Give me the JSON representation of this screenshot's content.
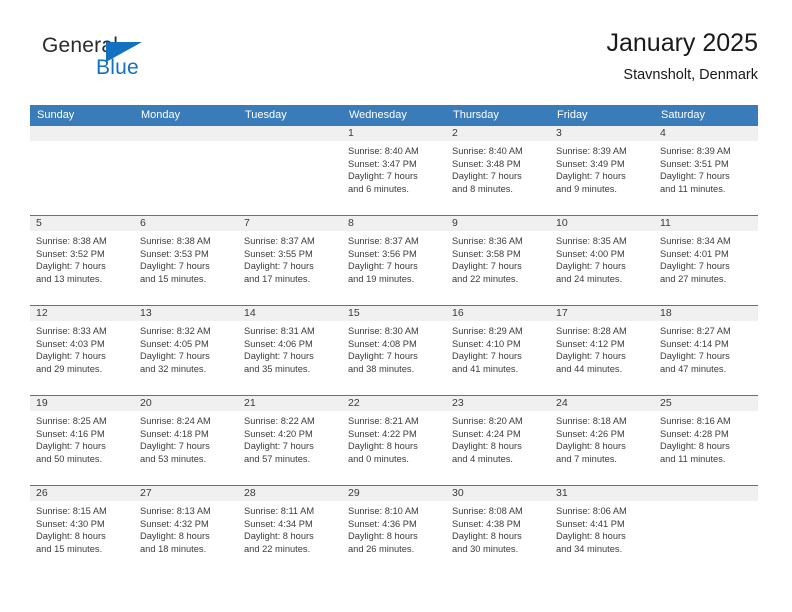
{
  "brand": {
    "name_top": "General",
    "name_bottom": "Blue",
    "accent_color": "#1271c0"
  },
  "header": {
    "title": "January 2025",
    "subtitle": "Stavnsholt, Denmark",
    "header_bg_color": "#3a7cb9",
    "daynum_bg_color": "#f0f0f0"
  },
  "weekdays": [
    "Sunday",
    "Monday",
    "Tuesday",
    "Wednesday",
    "Thursday",
    "Friday",
    "Saturday"
  ],
  "labels": {
    "sunrise": "Sunrise:",
    "sunset": "Sunset:",
    "daylight": "Daylight:"
  },
  "weeks": [
    [
      {
        "day": "",
        "empty": true
      },
      {
        "day": "",
        "empty": true
      },
      {
        "day": "",
        "empty": true
      },
      {
        "day": "1",
        "sunrise": "Sunrise: 8:40 AM",
        "sunset": "Sunset: 3:47 PM",
        "daylight1": "Daylight: 7 hours",
        "daylight2": "and 6 minutes."
      },
      {
        "day": "2",
        "sunrise": "Sunrise: 8:40 AM",
        "sunset": "Sunset: 3:48 PM",
        "daylight1": "Daylight: 7 hours",
        "daylight2": "and 8 minutes."
      },
      {
        "day": "3",
        "sunrise": "Sunrise: 8:39 AM",
        "sunset": "Sunset: 3:49 PM",
        "daylight1": "Daylight: 7 hours",
        "daylight2": "and 9 minutes."
      },
      {
        "day": "4",
        "sunrise": "Sunrise: 8:39 AM",
        "sunset": "Sunset: 3:51 PM",
        "daylight1": "Daylight: 7 hours",
        "daylight2": "and 11 minutes."
      }
    ],
    [
      {
        "day": "5",
        "sunrise": "Sunrise: 8:38 AM",
        "sunset": "Sunset: 3:52 PM",
        "daylight1": "Daylight: 7 hours",
        "daylight2": "and 13 minutes."
      },
      {
        "day": "6",
        "sunrise": "Sunrise: 8:38 AM",
        "sunset": "Sunset: 3:53 PM",
        "daylight1": "Daylight: 7 hours",
        "daylight2": "and 15 minutes."
      },
      {
        "day": "7",
        "sunrise": "Sunrise: 8:37 AM",
        "sunset": "Sunset: 3:55 PM",
        "daylight1": "Daylight: 7 hours",
        "daylight2": "and 17 minutes."
      },
      {
        "day": "8",
        "sunrise": "Sunrise: 8:37 AM",
        "sunset": "Sunset: 3:56 PM",
        "daylight1": "Daylight: 7 hours",
        "daylight2": "and 19 minutes."
      },
      {
        "day": "9",
        "sunrise": "Sunrise: 8:36 AM",
        "sunset": "Sunset: 3:58 PM",
        "daylight1": "Daylight: 7 hours",
        "daylight2": "and 22 minutes."
      },
      {
        "day": "10",
        "sunrise": "Sunrise: 8:35 AM",
        "sunset": "Sunset: 4:00 PM",
        "daylight1": "Daylight: 7 hours",
        "daylight2": "and 24 minutes."
      },
      {
        "day": "11",
        "sunrise": "Sunrise: 8:34 AM",
        "sunset": "Sunset: 4:01 PM",
        "daylight1": "Daylight: 7 hours",
        "daylight2": "and 27 minutes."
      }
    ],
    [
      {
        "day": "12",
        "sunrise": "Sunrise: 8:33 AM",
        "sunset": "Sunset: 4:03 PM",
        "daylight1": "Daylight: 7 hours",
        "daylight2": "and 29 minutes."
      },
      {
        "day": "13",
        "sunrise": "Sunrise: 8:32 AM",
        "sunset": "Sunset: 4:05 PM",
        "daylight1": "Daylight: 7 hours",
        "daylight2": "and 32 minutes."
      },
      {
        "day": "14",
        "sunrise": "Sunrise: 8:31 AM",
        "sunset": "Sunset: 4:06 PM",
        "daylight1": "Daylight: 7 hours",
        "daylight2": "and 35 minutes."
      },
      {
        "day": "15",
        "sunrise": "Sunrise: 8:30 AM",
        "sunset": "Sunset: 4:08 PM",
        "daylight1": "Daylight: 7 hours",
        "daylight2": "and 38 minutes."
      },
      {
        "day": "16",
        "sunrise": "Sunrise: 8:29 AM",
        "sunset": "Sunset: 4:10 PM",
        "daylight1": "Daylight: 7 hours",
        "daylight2": "and 41 minutes."
      },
      {
        "day": "17",
        "sunrise": "Sunrise: 8:28 AM",
        "sunset": "Sunset: 4:12 PM",
        "daylight1": "Daylight: 7 hours",
        "daylight2": "and 44 minutes."
      },
      {
        "day": "18",
        "sunrise": "Sunrise: 8:27 AM",
        "sunset": "Sunset: 4:14 PM",
        "daylight1": "Daylight: 7 hours",
        "daylight2": "and 47 minutes."
      }
    ],
    [
      {
        "day": "19",
        "sunrise": "Sunrise: 8:25 AM",
        "sunset": "Sunset: 4:16 PM",
        "daylight1": "Daylight: 7 hours",
        "daylight2": "and 50 minutes."
      },
      {
        "day": "20",
        "sunrise": "Sunrise: 8:24 AM",
        "sunset": "Sunset: 4:18 PM",
        "daylight1": "Daylight: 7 hours",
        "daylight2": "and 53 minutes."
      },
      {
        "day": "21",
        "sunrise": "Sunrise: 8:22 AM",
        "sunset": "Sunset: 4:20 PM",
        "daylight1": "Daylight: 7 hours",
        "daylight2": "and 57 minutes."
      },
      {
        "day": "22",
        "sunrise": "Sunrise: 8:21 AM",
        "sunset": "Sunset: 4:22 PM",
        "daylight1": "Daylight: 8 hours",
        "daylight2": "and 0 minutes."
      },
      {
        "day": "23",
        "sunrise": "Sunrise: 8:20 AM",
        "sunset": "Sunset: 4:24 PM",
        "daylight1": "Daylight: 8 hours",
        "daylight2": "and 4 minutes."
      },
      {
        "day": "24",
        "sunrise": "Sunrise: 8:18 AM",
        "sunset": "Sunset: 4:26 PM",
        "daylight1": "Daylight: 8 hours",
        "daylight2": "and 7 minutes."
      },
      {
        "day": "25",
        "sunrise": "Sunrise: 8:16 AM",
        "sunset": "Sunset: 4:28 PM",
        "daylight1": "Daylight: 8 hours",
        "daylight2": "and 11 minutes."
      }
    ],
    [
      {
        "day": "26",
        "sunrise": "Sunrise: 8:15 AM",
        "sunset": "Sunset: 4:30 PM",
        "daylight1": "Daylight: 8 hours",
        "daylight2": "and 15 minutes."
      },
      {
        "day": "27",
        "sunrise": "Sunrise: 8:13 AM",
        "sunset": "Sunset: 4:32 PM",
        "daylight1": "Daylight: 8 hours",
        "daylight2": "and 18 minutes."
      },
      {
        "day": "28",
        "sunrise": "Sunrise: 8:11 AM",
        "sunset": "Sunset: 4:34 PM",
        "daylight1": "Daylight: 8 hours",
        "daylight2": "and 22 minutes."
      },
      {
        "day": "29",
        "sunrise": "Sunrise: 8:10 AM",
        "sunset": "Sunset: 4:36 PM",
        "daylight1": "Daylight: 8 hours",
        "daylight2": "and 26 minutes."
      },
      {
        "day": "30",
        "sunrise": "Sunrise: 8:08 AM",
        "sunset": "Sunset: 4:38 PM",
        "daylight1": "Daylight: 8 hours",
        "daylight2": "and 30 minutes."
      },
      {
        "day": "31",
        "sunrise": "Sunrise: 8:06 AM",
        "sunset": "Sunset: 4:41 PM",
        "daylight1": "Daylight: 8 hours",
        "daylight2": "and 34 minutes."
      },
      {
        "day": "",
        "empty": true
      }
    ]
  ]
}
